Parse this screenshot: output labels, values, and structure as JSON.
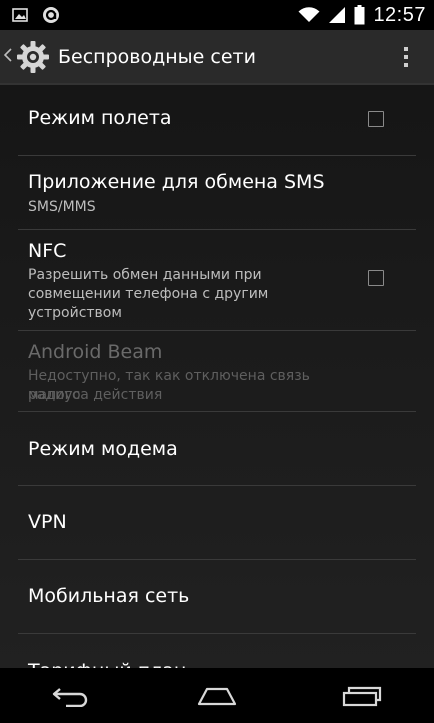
{
  "status_bar": {
    "time": "12:57",
    "icons": [
      "image-icon",
      "app-notification-icon",
      "wifi-icon",
      "signal-icon",
      "battery-icon"
    ]
  },
  "action_bar": {
    "title": "Беспроводные сети",
    "icons": [
      "back-chevron-icon",
      "settings-gear-icon",
      "overflow-menu-icon"
    ]
  },
  "settings": [
    {
      "title": "Режим полета",
      "summary": "",
      "checkbox": true,
      "checked": false,
      "enabled": true
    },
    {
      "title": "Приложение для обмена SMS",
      "summary": "SMS/MMS",
      "checkbox": false,
      "enabled": true
    },
    {
      "title": "NFC",
      "summary": "Разрешить обмен данными при совмещении телефона с другим устройством",
      "summary_lines": [
        "Разрешить обмен данными при",
        "совмещении телефона с другим",
        "устройством"
      ],
      "checkbox": true,
      "checked": false,
      "enabled": true
    },
    {
      "title": "Android Beam",
      "summary": "Недоступно, так как отключена связь малого радиуса действия",
      "summary_lines": [
        "Недоступно, так как отключена связь малого",
        "радиуса действия"
      ],
      "checkbox": false,
      "enabled": false
    },
    {
      "title": "Режим модема",
      "summary": "",
      "checkbox": false,
      "enabled": true
    },
    {
      "title": "VPN",
      "summary": "",
      "checkbox": false,
      "enabled": true
    },
    {
      "title": "Мобильная сеть",
      "summary": "",
      "checkbox": false,
      "enabled": true
    },
    {
      "title": "Тарифный план",
      "summary": "",
      "checkbox": false,
      "enabled": true
    }
  ],
  "nav_bar": {
    "icons": [
      "back-icon",
      "home-icon",
      "recent-apps-icon"
    ]
  },
  "colors": {
    "status_bar_bg": "#000000",
    "action_bar_bg": "#2a2a2a",
    "text_primary": "#ffffff",
    "text_secondary": "#bdbdbd",
    "text_disabled": "#6a6a6a",
    "divider": "#3a3a3a"
  }
}
